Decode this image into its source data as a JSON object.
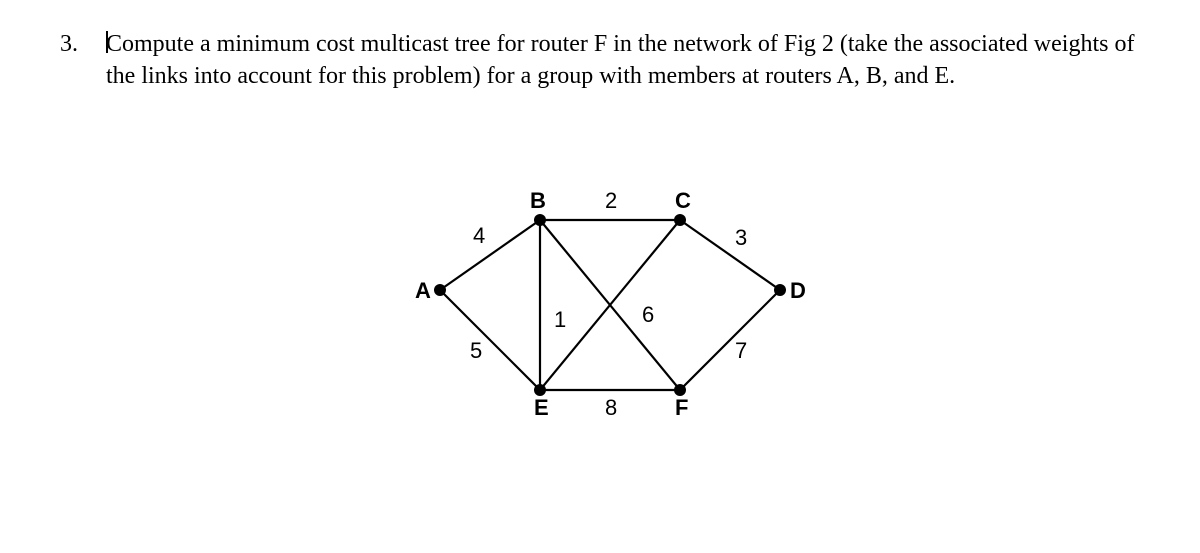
{
  "question": {
    "number": "3.",
    "text": "Compute a minimum cost multicast tree for router F in the network of Fig 2 (take the associated weights of the links into account for this problem) for a group with members at routers A, B, and E."
  },
  "graph": {
    "nodes": {
      "A": "A",
      "B": "B",
      "C": "C",
      "D": "D",
      "E": "E",
      "F": "F"
    },
    "edges": {
      "AB": "4",
      "BC": "2",
      "CD": "3",
      "AE": "5",
      "BE": "1",
      "BF": "6",
      "DF": "7",
      "EF": "8"
    }
  },
  "chart_data": {
    "type": "diagram",
    "caption_ref": "Fig 2",
    "nodes": [
      "A",
      "B",
      "C",
      "D",
      "E",
      "F"
    ],
    "edges": [
      {
        "from": "A",
        "to": "B",
        "weight": 4
      },
      {
        "from": "B",
        "to": "C",
        "weight": 2
      },
      {
        "from": "C",
        "to": "D",
        "weight": 3
      },
      {
        "from": "A",
        "to": "E",
        "weight": 5
      },
      {
        "from": "B",
        "to": "E",
        "weight": 1
      },
      {
        "from": "B",
        "to": "F",
        "weight": 6
      },
      {
        "from": "D",
        "to": "F",
        "weight": 7
      },
      {
        "from": "E",
        "to": "F",
        "weight": 8
      }
    ]
  }
}
